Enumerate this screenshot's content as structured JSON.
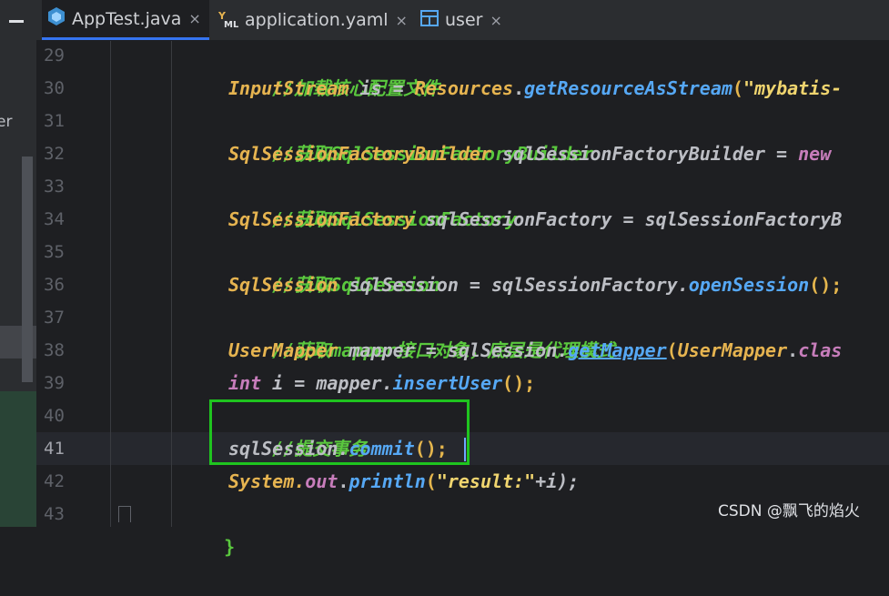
{
  "tabs": [
    {
      "label": "AppTest.java",
      "icon": "java-class-icon",
      "active": true
    },
    {
      "label": "application.yaml",
      "icon": "yaml-icon",
      "active": false
    },
    {
      "label": "user",
      "icon": "table-icon",
      "active": false
    }
  ],
  "close_glyph": "×",
  "left_panel": {
    "partial_text": "er"
  },
  "line_numbers": [
    "29",
    "30",
    "31",
    "32",
    "33",
    "34",
    "35",
    "36",
    "37",
    "38",
    "39",
    "40",
    "41",
    "42",
    "43"
  ],
  "code": {
    "l29": "//加载核心配置文件",
    "l30": {
      "t1": "InputStream",
      "t2": " is = ",
      "t3": "Resources",
      "t4": ".",
      "t5": "getResourceAsStream",
      "t6": "(",
      "t7": "\"mybatis-"
    },
    "l31": "//获取SqlSessionFactoryBuilder",
    "l32": {
      "t1": "SqlSessionFactoryBuilder",
      "t2": " sqlSessionFactoryBuilder = ",
      "t3": "new"
    },
    "l33": "//获取SqlSessionFactory",
    "l34": {
      "t1": "SqlSessionFactory",
      "t2": " sqlSessionFactory = sqlSessionFactoryB"
    },
    "l35": "//获取SqlSession",
    "l36": {
      "t1": "SqlSession",
      "t2": " sqlSession = sqlSessionFactory.",
      "t3": "openSession",
      "t4": "();"
    },
    "l37": "//获取mapper接口对象，底层是代理模式",
    "l38": {
      "t1": "UserMapper",
      "t2": " mapper = sqlSession.",
      "t3": "getMapper",
      "t4": "(",
      "t5": "UserMapper",
      "t6": ".",
      "t7": "clas"
    },
    "l39": {
      "t1": "int",
      "t2": " i = mapper.",
      "t3": "insertUser",
      "t4": "();"
    },
    "l40": "//提交事务",
    "l41": {
      "t1": "sqlSession.",
      "t2": "commit",
      "t3": "();"
    },
    "l42": {
      "t1": "System.",
      "t2": "out",
      "t3": ".",
      "t4": "println",
      "t5": "(",
      "t6": "\"result:\"",
      "t7": "+i);"
    },
    "l43": "}"
  },
  "watermark": "CSDN @飘飞的焰火",
  "colors": {
    "comment": "#5ac83e",
    "type": "#e6b450",
    "method": "#56a8f5",
    "keyword": "#c77dbb",
    "highlight_box": "#1fc41f"
  }
}
